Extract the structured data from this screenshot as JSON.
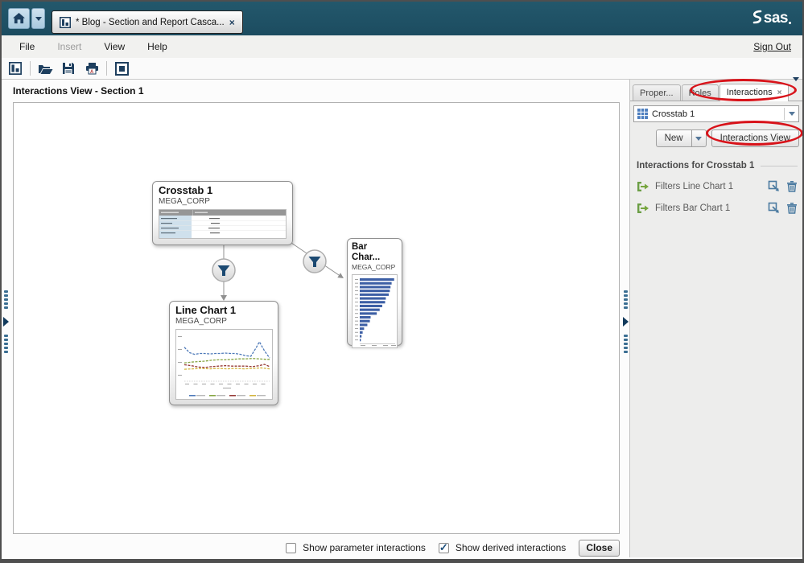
{
  "banner": {
    "tab_title": "* Blog - Section and Report Casca...",
    "tab_close": "×",
    "logo_text": "sas"
  },
  "menu": {
    "file": "File",
    "insert": "Insert",
    "view": "View",
    "help": "Help",
    "sign_out": "Sign Out"
  },
  "toolbar_icons": [
    "report-icon",
    "open-folder-icon",
    "save-icon",
    "print-pdf-icon",
    "view-frame-icon"
  ],
  "canvas": {
    "title": "Interactions View - Section 1"
  },
  "footer": {
    "show_parameter_label": "Show parameter interactions",
    "show_parameter_checked": false,
    "show_derived_label": "Show derived interactions",
    "show_derived_checked": true,
    "close_label": "Close"
  },
  "panel": {
    "tabs": {
      "properties": "Proper...",
      "roles": "Roles",
      "interactions": "Interactions",
      "interactions_close": "×"
    },
    "object_selector_value": "Crosstab 1",
    "new_button": "New",
    "interactions_view_button": "Interactions View",
    "section_header": "Interactions for Crosstab 1",
    "items": [
      {
        "label": "Filters Line Chart 1"
      },
      {
        "label": "Filters Bar Chart 1"
      }
    ]
  },
  "diagram": {
    "nodes": {
      "crosstab": {
        "title": "Crosstab 1",
        "subtitle": "MEGA_CORP"
      },
      "line": {
        "title": "Line Chart 1",
        "subtitle": "MEGA_CORP"
      },
      "bar": {
        "title": "Bar Char...",
        "subtitle": "MEGA_CORP"
      }
    },
    "bar_thumbnail": {
      "type": "bar",
      "bar_color": "#3d5fa5",
      "values": [
        95,
        88,
        85,
        83,
        80,
        72,
        70,
        62,
        55,
        47,
        30,
        28,
        21,
        12,
        8,
        5,
        3
      ]
    },
    "line_thumbnail": {
      "type": "line",
      "series": [
        {
          "color": "#4d79b8",
          "points": [
            [
              0,
              28
            ],
            [
              6,
              40
            ],
            [
              12,
              44
            ],
            [
              18,
              42
            ],
            [
              24,
              42
            ],
            [
              30,
              43
            ],
            [
              36,
              42
            ],
            [
              42,
              42
            ],
            [
              48,
              41
            ],
            [
              54,
              42
            ],
            [
              60,
              42
            ],
            [
              66,
              44
            ],
            [
              72,
              47
            ],
            [
              78,
              48
            ],
            [
              84,
              30
            ],
            [
              88,
              16
            ],
            [
              94,
              36
            ],
            [
              100,
              52
            ]
          ]
        },
        {
          "color": "#86a542",
          "points": [
            [
              0,
              63
            ],
            [
              8,
              61
            ],
            [
              16,
              60
            ],
            [
              24,
              59
            ],
            [
              32,
              57
            ],
            [
              40,
              56
            ],
            [
              48,
              56
            ],
            [
              56,
              55
            ],
            [
              64,
              54
            ],
            [
              72,
              54
            ],
            [
              80,
              53
            ],
            [
              88,
              54
            ],
            [
              96,
              55
            ],
            [
              100,
              55
            ]
          ]
        },
        {
          "color": "#973b38",
          "points": [
            [
              0,
              67
            ],
            [
              8,
              69
            ],
            [
              16,
              72
            ],
            [
              24,
              73
            ],
            [
              32,
              71
            ],
            [
              40,
              70
            ],
            [
              48,
              69
            ],
            [
              56,
              70
            ],
            [
              64,
              70
            ],
            [
              72,
              70
            ],
            [
              80,
              71
            ],
            [
              88,
              69
            ],
            [
              94,
              66
            ],
            [
              100,
              71
            ]
          ]
        },
        {
          "color": "#d2b53f",
          "points": [
            [
              0,
              77
            ],
            [
              10,
              76
            ],
            [
              20,
              75
            ],
            [
              30,
              76
            ],
            [
              40,
              75
            ],
            [
              50,
              76
            ],
            [
              60,
              75
            ],
            [
              70,
              76
            ],
            [
              80,
              75
            ],
            [
              90,
              74
            ],
            [
              100,
              76
            ]
          ]
        }
      ]
    }
  },
  "colors": {
    "banner_background": "#1e5064",
    "icon_navy": "#1e3f5f",
    "annotation_red": "#d8131a",
    "funnel_blue": "#1b4971",
    "list_icon_green": "#76a53e",
    "list_icon_blue": "#4a7aa0",
    "crosstab_row_blue": "#cfe0ec"
  }
}
